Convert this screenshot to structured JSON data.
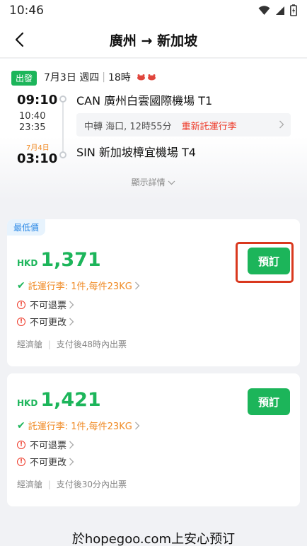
{
  "status_bar": {
    "time": "10:46"
  },
  "header": {
    "title": "廣州 → 新加坡"
  },
  "flight": {
    "depart_badge": "出發",
    "date": "7月3日 週四",
    "duration": "18時",
    "dep_time": "09:10",
    "transfer_time_1": "10:40",
    "transfer_time_2": "23:35",
    "arr_date": "7月4日",
    "arr_time": "03:10",
    "dep_airport": "CAN 廣州白雲國際機場 T1",
    "transfer_info": "中轉 海口, 12時55分",
    "recheck": "重新託運行李",
    "arr_airport": "SIN 新加坡樟宜機場 T4",
    "details_link": "顯示詳情"
  },
  "offers": [
    {
      "tag": "最低價",
      "currency": "HKD",
      "price": "1,371",
      "baggage": "託運行李: 1件,每件23KG",
      "refund": "不可退票",
      "change": "不可更改",
      "cabin": "經濟艙",
      "ticketing": "支付後48時內出票",
      "book_label": "預訂"
    },
    {
      "currency": "HKD",
      "price": "1,421",
      "baggage": "託運行李: 1件,每件23KG",
      "refund": "不可退票",
      "change": "不可更改",
      "cabin": "經濟艙",
      "ticketing": "支付後30分內出票",
      "book_label": "預訂"
    }
  ],
  "watermark": "於hopegoo.com上安心预订",
  "colors": {
    "green": "#1cb55a",
    "orange": "#f08a24",
    "red": "#ee3b2a",
    "highlight": "#d9381e"
  }
}
